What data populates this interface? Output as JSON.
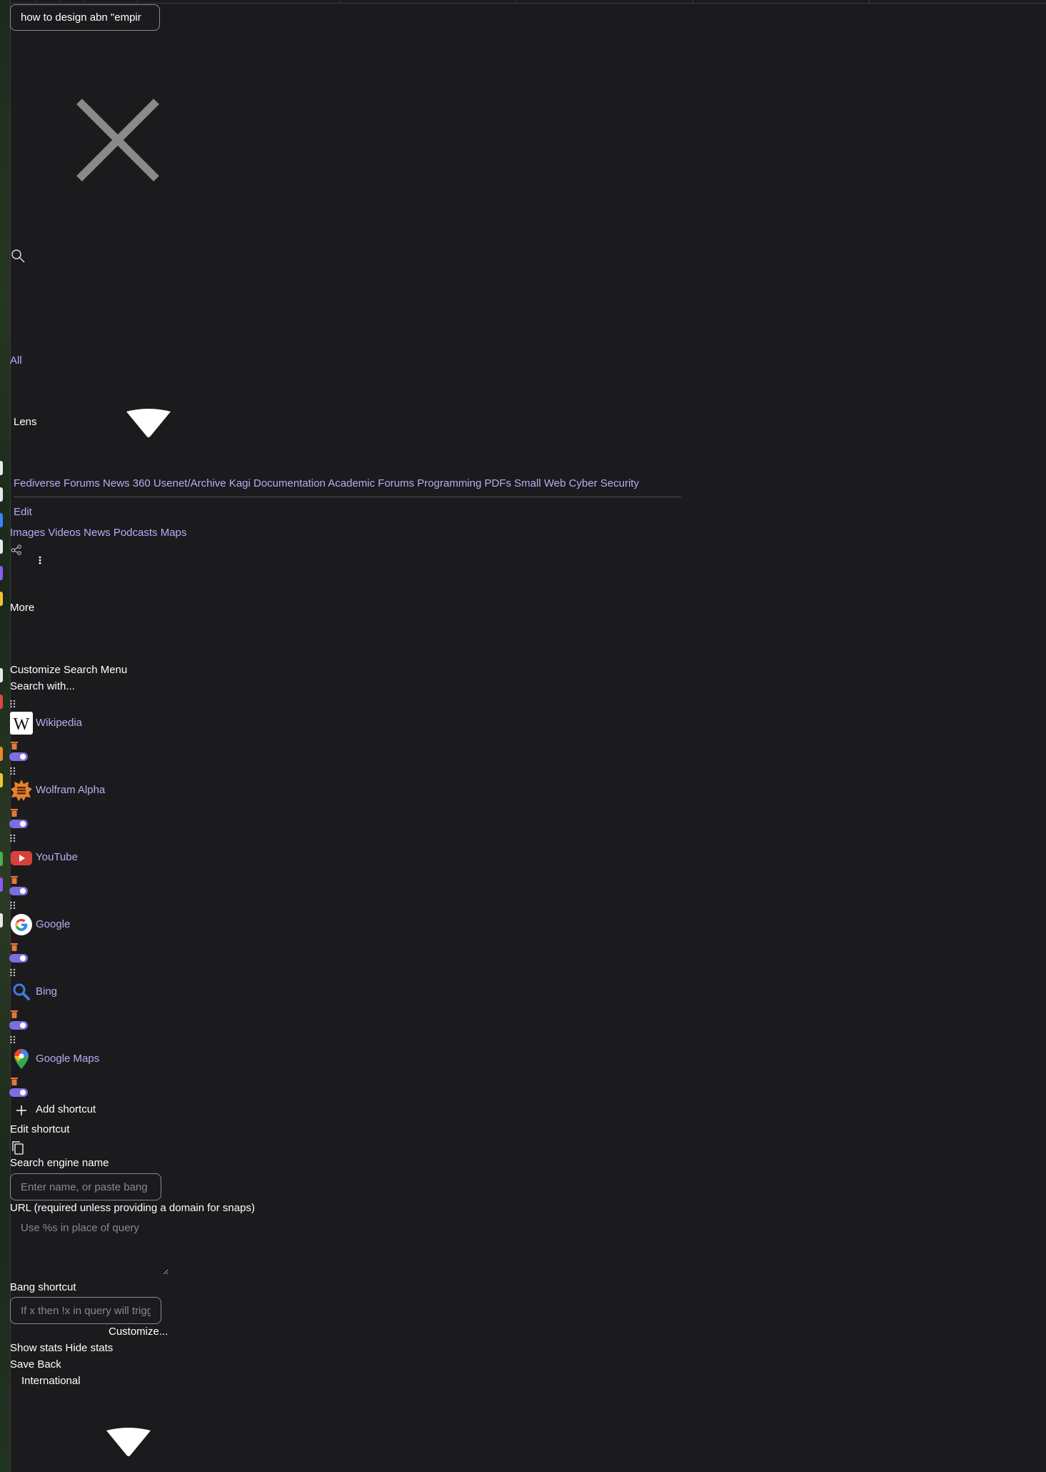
{
  "search": {
    "query": "how to design abn \"empir"
  },
  "tabs": {
    "all": "All",
    "lens": "Lens"
  },
  "lenses": [
    "Fediverse Forums",
    "News 360",
    "Usenet/Archive",
    "Kagi Documentation",
    "Academic",
    "Forums",
    "Programming",
    "PDFs",
    "Small Web",
    "Cyber Security"
  ],
  "lens_edit": "Edit",
  "media_tabs": [
    "Images",
    "Videos",
    "News",
    "Podcasts",
    "Maps"
  ],
  "more_label": "More",
  "menu": {
    "customize_title": "Customize Search Menu",
    "search_with": "Search with...",
    "engines": [
      "Wikipedia",
      "Wolfram Alpha",
      "YouTube",
      "Google",
      "Bing",
      "Google Maps"
    ],
    "add_shortcut": "Add shortcut"
  },
  "edit_form": {
    "title": "Edit shortcut",
    "name_label": "Search engine name",
    "name_placeholder": "Enter name, or paste bang",
    "url_label": "URL (required unless providing a domain for snaps)",
    "url_placeholder": "Use %s in place of query",
    "bang_label": "Bang shortcut",
    "bang_placeholder": "If x then !x in query will trigger",
    "customize": "Customize...",
    "show_stats": "Show stats",
    "hide_stats": "Hide stats",
    "save": "Save",
    "back": "Back"
  },
  "region": {
    "selected": "International"
  },
  "colors": {
    "background": "#1b1b1e",
    "accent_link": "#b7aef2",
    "toggle": "#7b6fe0",
    "trash": "#e07a3a"
  },
  "icons": [
    "close-icon",
    "search-icon",
    "chevron-down-icon",
    "share-icon",
    "more-vertical-icon",
    "drag-handle-icon",
    "trash-icon",
    "toggle-switch",
    "plus-icon",
    "copy-icon"
  ]
}
